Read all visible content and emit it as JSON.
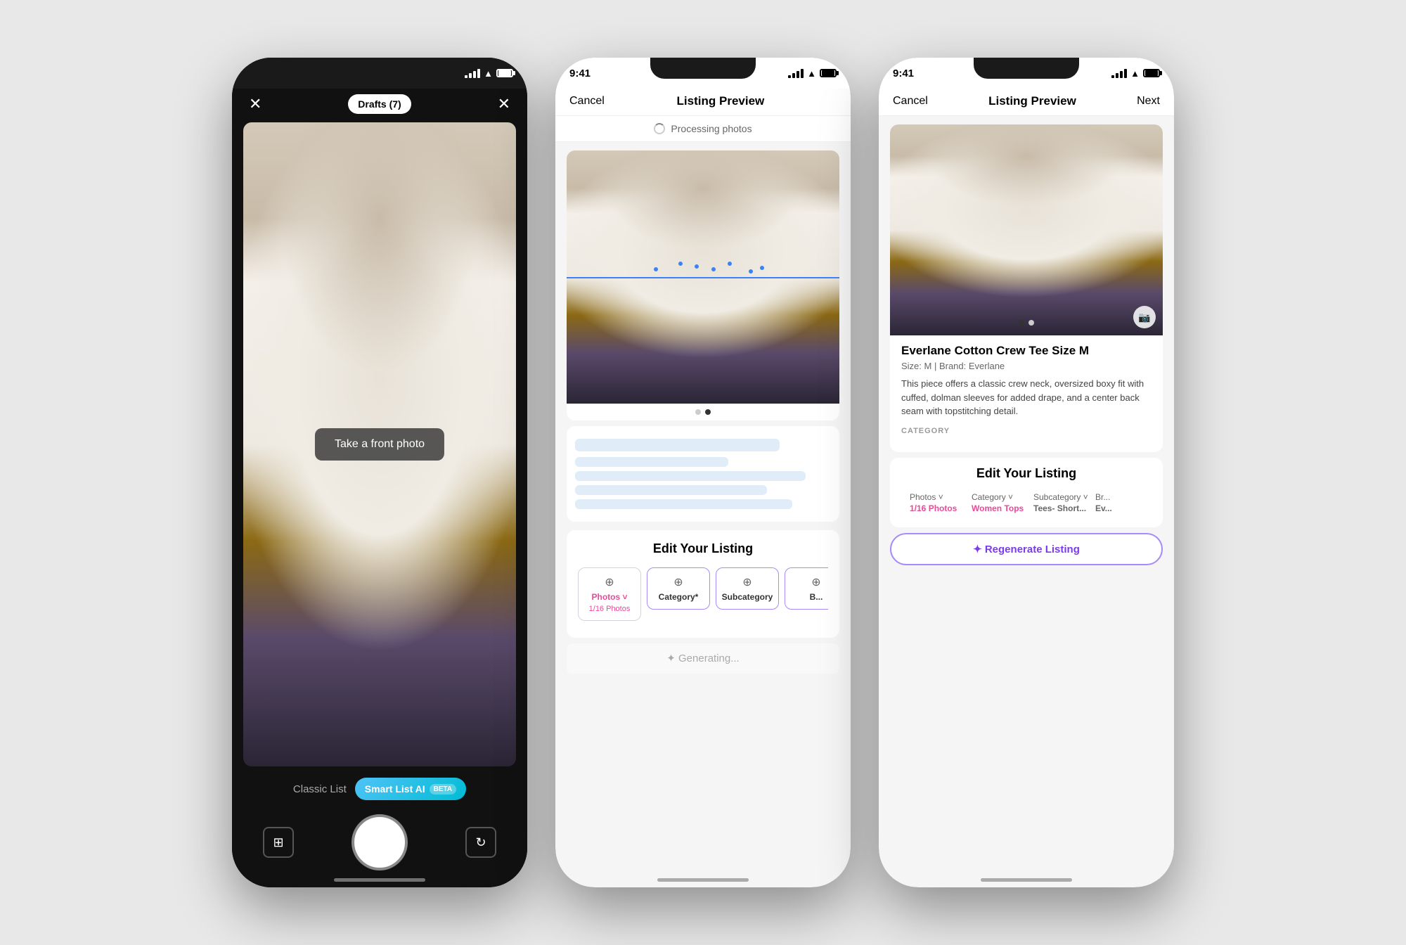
{
  "phone1": {
    "status_time": "",
    "drafts_label": "Drafts (7)",
    "take_photo_label": "Take a front photo",
    "mode_classic": "Classic List",
    "mode_smart": "Smart List AI",
    "mode_beta": "BETA"
  },
  "phone2": {
    "status_time": "9:41",
    "nav_cancel": "Cancel",
    "nav_title": "Listing Preview",
    "processing_text": "Processing photos",
    "edit_title": "Edit Your Listing",
    "tabs": [
      {
        "icon": "⊕",
        "label": "Photos",
        "sublabel": "1/16 Photos",
        "pink": true,
        "active": false
      },
      {
        "icon": "⊕",
        "label": "Category*",
        "sublabel": "",
        "active": true
      },
      {
        "icon": "⊕",
        "label": "Subcategory",
        "sublabel": "",
        "active": true
      }
    ],
    "generating_text": "✦ Generating..."
  },
  "phone3": {
    "status_time": "9:41",
    "nav_cancel": "Cancel",
    "nav_title": "Listing Preview",
    "nav_next": "Next",
    "listing_title": "Everlane Cotton Crew Tee Size M",
    "listing_meta": "Size: M  |  Brand: Everlane",
    "listing_desc": "This piece offers a classic crew neck, oversized boxy fit with cuffed, dolman sleeves for added drape, and a center back seam with topstitching detail.",
    "category_label": "CATEGORY",
    "edit_title": "Edit Your Listing",
    "tabs": [
      {
        "label": "Photos ˅",
        "sublabel": "1/16 Photos",
        "pink_sub": true
      },
      {
        "label": "Category ˅",
        "sublabel": "Women Tops",
        "pink_sub": true
      },
      {
        "label": "Subcategory ˅",
        "sublabel": "Tees- Short...",
        "pink_sub": false
      },
      {
        "label": "Br...",
        "sublabel": "Ev...",
        "pink_sub": false
      }
    ],
    "regen_label": "✦ Regenerate Listing",
    "dots": [
      "",
      ""
    ],
    "photo_dots": [
      "",
      ""
    ]
  }
}
